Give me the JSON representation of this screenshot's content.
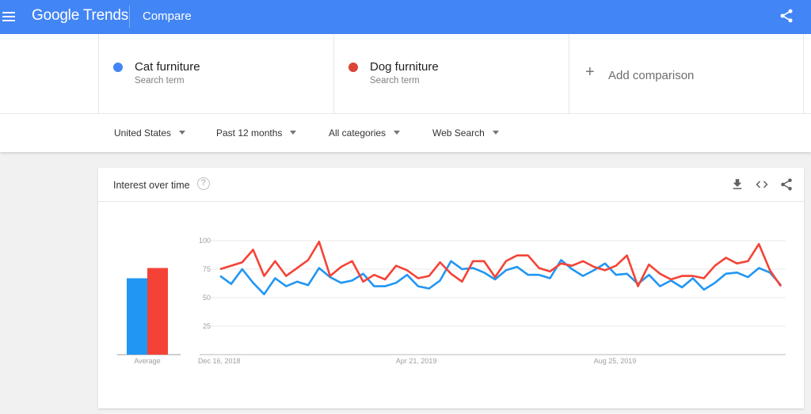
{
  "header": {
    "brand_google": "Google",
    "brand_trends": "Trends",
    "page_title": "Compare",
    "menu_icon": "hamburger-menu-icon",
    "share_icon": "share-icon"
  },
  "terms": [
    {
      "name": "Cat furniture",
      "type": "Search term",
      "color": "#4285f4"
    },
    {
      "name": "Dog furniture",
      "type": "Search term",
      "color": "#db4437"
    }
  ],
  "add_comparison": {
    "icon": "plus-icon",
    "label": "Add comparison"
  },
  "filters": [
    {
      "label": "United States"
    },
    {
      "label": "Past 12 months"
    },
    {
      "label": "All categories"
    },
    {
      "label": "Web Search"
    }
  ],
  "card": {
    "title": "Interest over time",
    "help_icon": "?",
    "tools": [
      "download-icon",
      "embed-code-icon",
      "share-icon"
    ]
  },
  "chart_data": {
    "type": "line",
    "title": "Interest over time",
    "ylim": [
      0,
      100
    ],
    "yticks": [
      25,
      50,
      75,
      100
    ],
    "grid": true,
    "xtick_labels": [
      {
        "index": 0,
        "label": "Dec 16, 2018"
      },
      {
        "index": 18,
        "label": "Apr 21, 2019"
      },
      {
        "index": 36,
        "label": "Aug 25, 2019"
      }
    ],
    "x_start": "Dec 16, 2018",
    "x_interval": "weekly",
    "average": {
      "label": "Average",
      "values": [
        {
          "name": "Cat furniture",
          "value": 67,
          "color": "#2196f3"
        },
        {
          "name": "Dog furniture",
          "value": 76,
          "color": "#f44336"
        }
      ]
    },
    "series": [
      {
        "name": "Cat furniture",
        "color": "#2196f3",
        "values": [
          69,
          62,
          75,
          63,
          53,
          67,
          60,
          64,
          61,
          76,
          68,
          63,
          65,
          71,
          60,
          60,
          63,
          70,
          60,
          58,
          65,
          82,
          75,
          76,
          72,
          66,
          74,
          77,
          70,
          70,
          67,
          83,
          75,
          69,
          74,
          80,
          70,
          71,
          62,
          70,
          60,
          65,
          59,
          67,
          57,
          63,
          71,
          72,
          68,
          76,
          72,
          61
        ]
      },
      {
        "name": "Dog furniture",
        "color": "#f44336",
        "values": [
          75,
          78,
          81,
          92,
          69,
          82,
          69,
          76,
          83,
          99,
          69,
          77,
          82,
          64,
          70,
          66,
          78,
          74,
          67,
          69,
          81,
          71,
          64,
          82,
          82,
          68,
          82,
          87,
          87,
          76,
          73,
          80,
          78,
          82,
          77,
          74,
          78,
          87,
          60,
          79,
          71,
          66,
          69,
          69,
          67,
          78,
          85,
          80,
          82,
          97,
          74,
          60
        ]
      }
    ]
  }
}
